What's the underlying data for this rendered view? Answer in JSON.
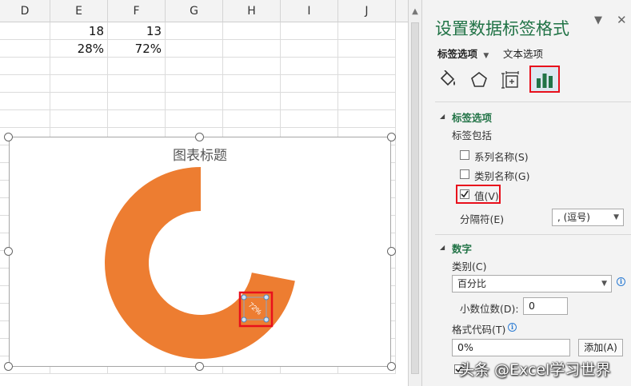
{
  "sheet": {
    "columns": [
      {
        "label": "D"
      },
      {
        "label": "E"
      },
      {
        "label": "F"
      },
      {
        "label": "G"
      },
      {
        "label": "H"
      },
      {
        "label": "I"
      },
      {
        "label": "J"
      }
    ],
    "rows": [
      [
        "",
        "18",
        "13"
      ],
      [
        "",
        "28%",
        "72%"
      ]
    ]
  },
  "chart": {
    "title": "图表标题",
    "selected_label": "72%"
  },
  "chart_data": {
    "type": "pie",
    "title": "图表标题",
    "categories": [
      "28%",
      "72%"
    ],
    "values": [
      0.28,
      0.72
    ],
    "visible_segments": [
      "72%"
    ],
    "labels": [
      "72%"
    ],
    "colors": [
      "#ffffff",
      "#ed7d31"
    ]
  },
  "pane": {
    "title": "设置数据标签格式",
    "tabs": {
      "label_options": "标签选项",
      "text_options": "文本选项"
    },
    "icons": [
      "fill-line-icon",
      "effects-icon",
      "size-properties-icon",
      "label-options-icon"
    ],
    "label_section": {
      "heading": "标签选项",
      "contains": "标签包括",
      "series_name": "系列名称(S)",
      "category_name": "类别名称(G)",
      "value": "值(V)",
      "series_checked": false,
      "category_checked": false,
      "value_checked": true,
      "separator_label": "分隔符(E)",
      "separator_value": ", (逗号)"
    },
    "number_section": {
      "heading": "数字",
      "category_label": "类别(C)",
      "category_value": "百分比",
      "decimals_label": "小数位数(D):",
      "decimals_value": "0",
      "format_code_label": "格式代码(T)",
      "format_code_value": "0%",
      "add_button": "添加(A)"
    },
    "accent_color": "#217346",
    "highlight_color": "#e8101c"
  },
  "watermark": "头条 @Excel学习世界"
}
